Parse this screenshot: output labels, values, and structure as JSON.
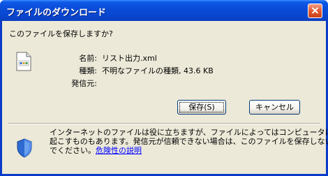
{
  "window": {
    "title": "ファイルのダウンロード"
  },
  "prompt": {
    "question": "このファイルを保存しますか?"
  },
  "file": {
    "icon": "xml-file-icon",
    "name_label": "名前:",
    "name_value": "リスト出力.xml",
    "type_label": "種類:",
    "type_value": "不明なファイルの種類, 43.6 KB",
    "from_label": "発信元:",
    "from_value": ""
  },
  "buttons": {
    "save": "保存(S)",
    "cancel": "キャンセル"
  },
  "warning": {
    "icon": "shield-icon",
    "line1": "インターネットのファイルは役に立ちますが、ファイルによってはコンピュータに問題を",
    "line2": "起こすものもあります。発信元が信頼できない場合は、このファイルを保存しない",
    "line3_prefix": "でください。",
    "link": "危険性の説明"
  },
  "colors": {
    "titlebar": "#0A4CD8",
    "dialog_bg": "#ECE9D8",
    "link": "#0000FF",
    "close_button": "#E2582F"
  }
}
